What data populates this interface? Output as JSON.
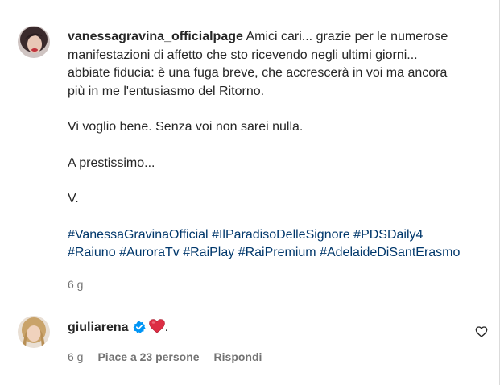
{
  "comments": [
    {
      "username": "vanessagravina_officialpage",
      "lines": [
        "Amici cari... grazie per le numerose",
        "manifestazioni di affetto che sto ricevendo negli ultimi giorni...",
        "abbiate fiducia: è una fuga breve, che accrescerà in voi ma ancora",
        "più in me l'entusiasmo del Ritorno."
      ],
      "para2": "Vi voglio bene. Senza voi non sarei nulla.",
      "para3": "A prestissimo...",
      "para4": "V.",
      "hashtags": [
        "#VanessaGravinaOfficial",
        "#IlParadisoDelleSignore",
        "#PDSDaily4",
        "#Raiuno",
        "#AuroraTv",
        "#RaiPlay",
        "#RaiPremium",
        "#AdelaideDiSantErasmo"
      ],
      "time": "6 g"
    },
    {
      "username": "giuliarena",
      "text": ".",
      "time": "6 g",
      "likes": "Piace a 23 persone",
      "reply": "Rispondi"
    }
  ],
  "icons": {
    "verified": "verified-badge-icon",
    "emoji": "red-heart-emoji",
    "like": "heart-outline-icon"
  },
  "colors": {
    "text": "#262626",
    "secondary": "#737373",
    "hashtag": "#00376b",
    "verified": "#0095f6",
    "heart": "#e0245e"
  }
}
